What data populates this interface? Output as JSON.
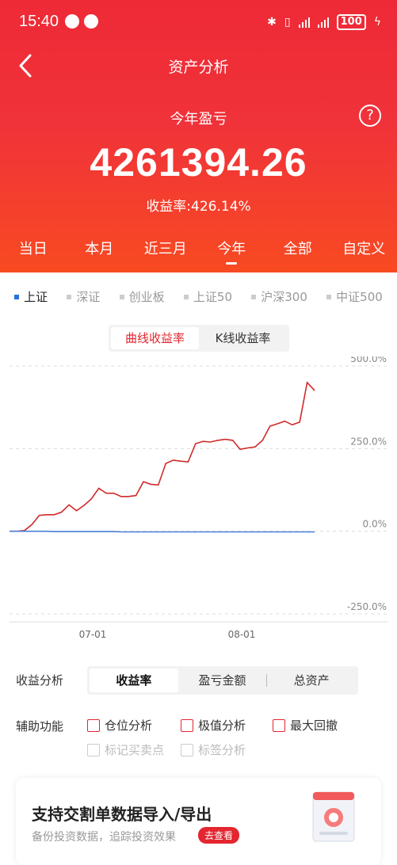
{
  "status": {
    "time": "15:40",
    "battery": "100"
  },
  "nav": {
    "title": "资产分析"
  },
  "summary": {
    "label": "今年盈亏",
    "amount": "4261394.26",
    "rate": "收益率:426.14%",
    "help": "?"
  },
  "period_tabs": [
    "当日",
    "本月",
    "近三月",
    "今年",
    "全部",
    "自定义"
  ],
  "period_active": "今年",
  "index_tabs": [
    "上证",
    "深证",
    "创业板",
    "上证50",
    "沪深300",
    "中证500"
  ],
  "index_active": "上证",
  "chart_toggle": {
    "curve": "曲线收益率",
    "kline": "K线收益率"
  },
  "chart_data": {
    "type": "line",
    "title": "",
    "xlabel": "",
    "ylabel": "",
    "ylim": [
      -250,
      500
    ],
    "yticks": [
      "500.0%",
      "250.0%",
      "0.0%",
      "-250.0%"
    ],
    "xticks": [
      "07-01",
      "08-01"
    ],
    "grid": true,
    "series": [
      {
        "color": "#d02a2a",
        "values": [
          0,
          0,
          2,
          20,
          48,
          50,
          50,
          58,
          80,
          62,
          78,
          98,
          130,
          115,
          115,
          105,
          105,
          108,
          150,
          142,
          140,
          205,
          215,
          212,
          210,
          265,
          272,
          270,
          275,
          278,
          275,
          248,
          252,
          255,
          275,
          318,
          325,
          333,
          322,
          330,
          450,
          426
        ]
      },
      {
        "color": "#4a7fd8",
        "values": [
          0,
          0,
          0,
          0,
          0,
          0,
          -1,
          -1,
          -1,
          -1,
          -1,
          -1,
          -1,
          -1,
          -1,
          -2,
          -2,
          -2,
          -2,
          -2,
          -2,
          -2,
          -2,
          -2,
          -2,
          -2,
          -2,
          -2,
          -2,
          -2,
          -2,
          -2,
          -2,
          -2,
          -2,
          -2,
          -2,
          -2,
          -2,
          -2,
          -2,
          -2
        ]
      }
    ]
  },
  "analysis": {
    "label": "收益分析",
    "options": [
      "收益率",
      "盈亏金额",
      "总资产"
    ],
    "active": "收益率"
  },
  "aux": {
    "label": "辅助功能",
    "row1": [
      "仓位分析",
      "极值分析",
      "最大回撤"
    ],
    "row2": [
      "标记买卖点",
      "标签分析"
    ]
  },
  "promo": {
    "title": "支持交割单数据导入/导出",
    "subtitle": "备份投资数据，追踪投资效果",
    "button": "去查看"
  },
  "colors": {
    "brand_red": "#e3262f",
    "index_blue": "#2b6fe0"
  }
}
